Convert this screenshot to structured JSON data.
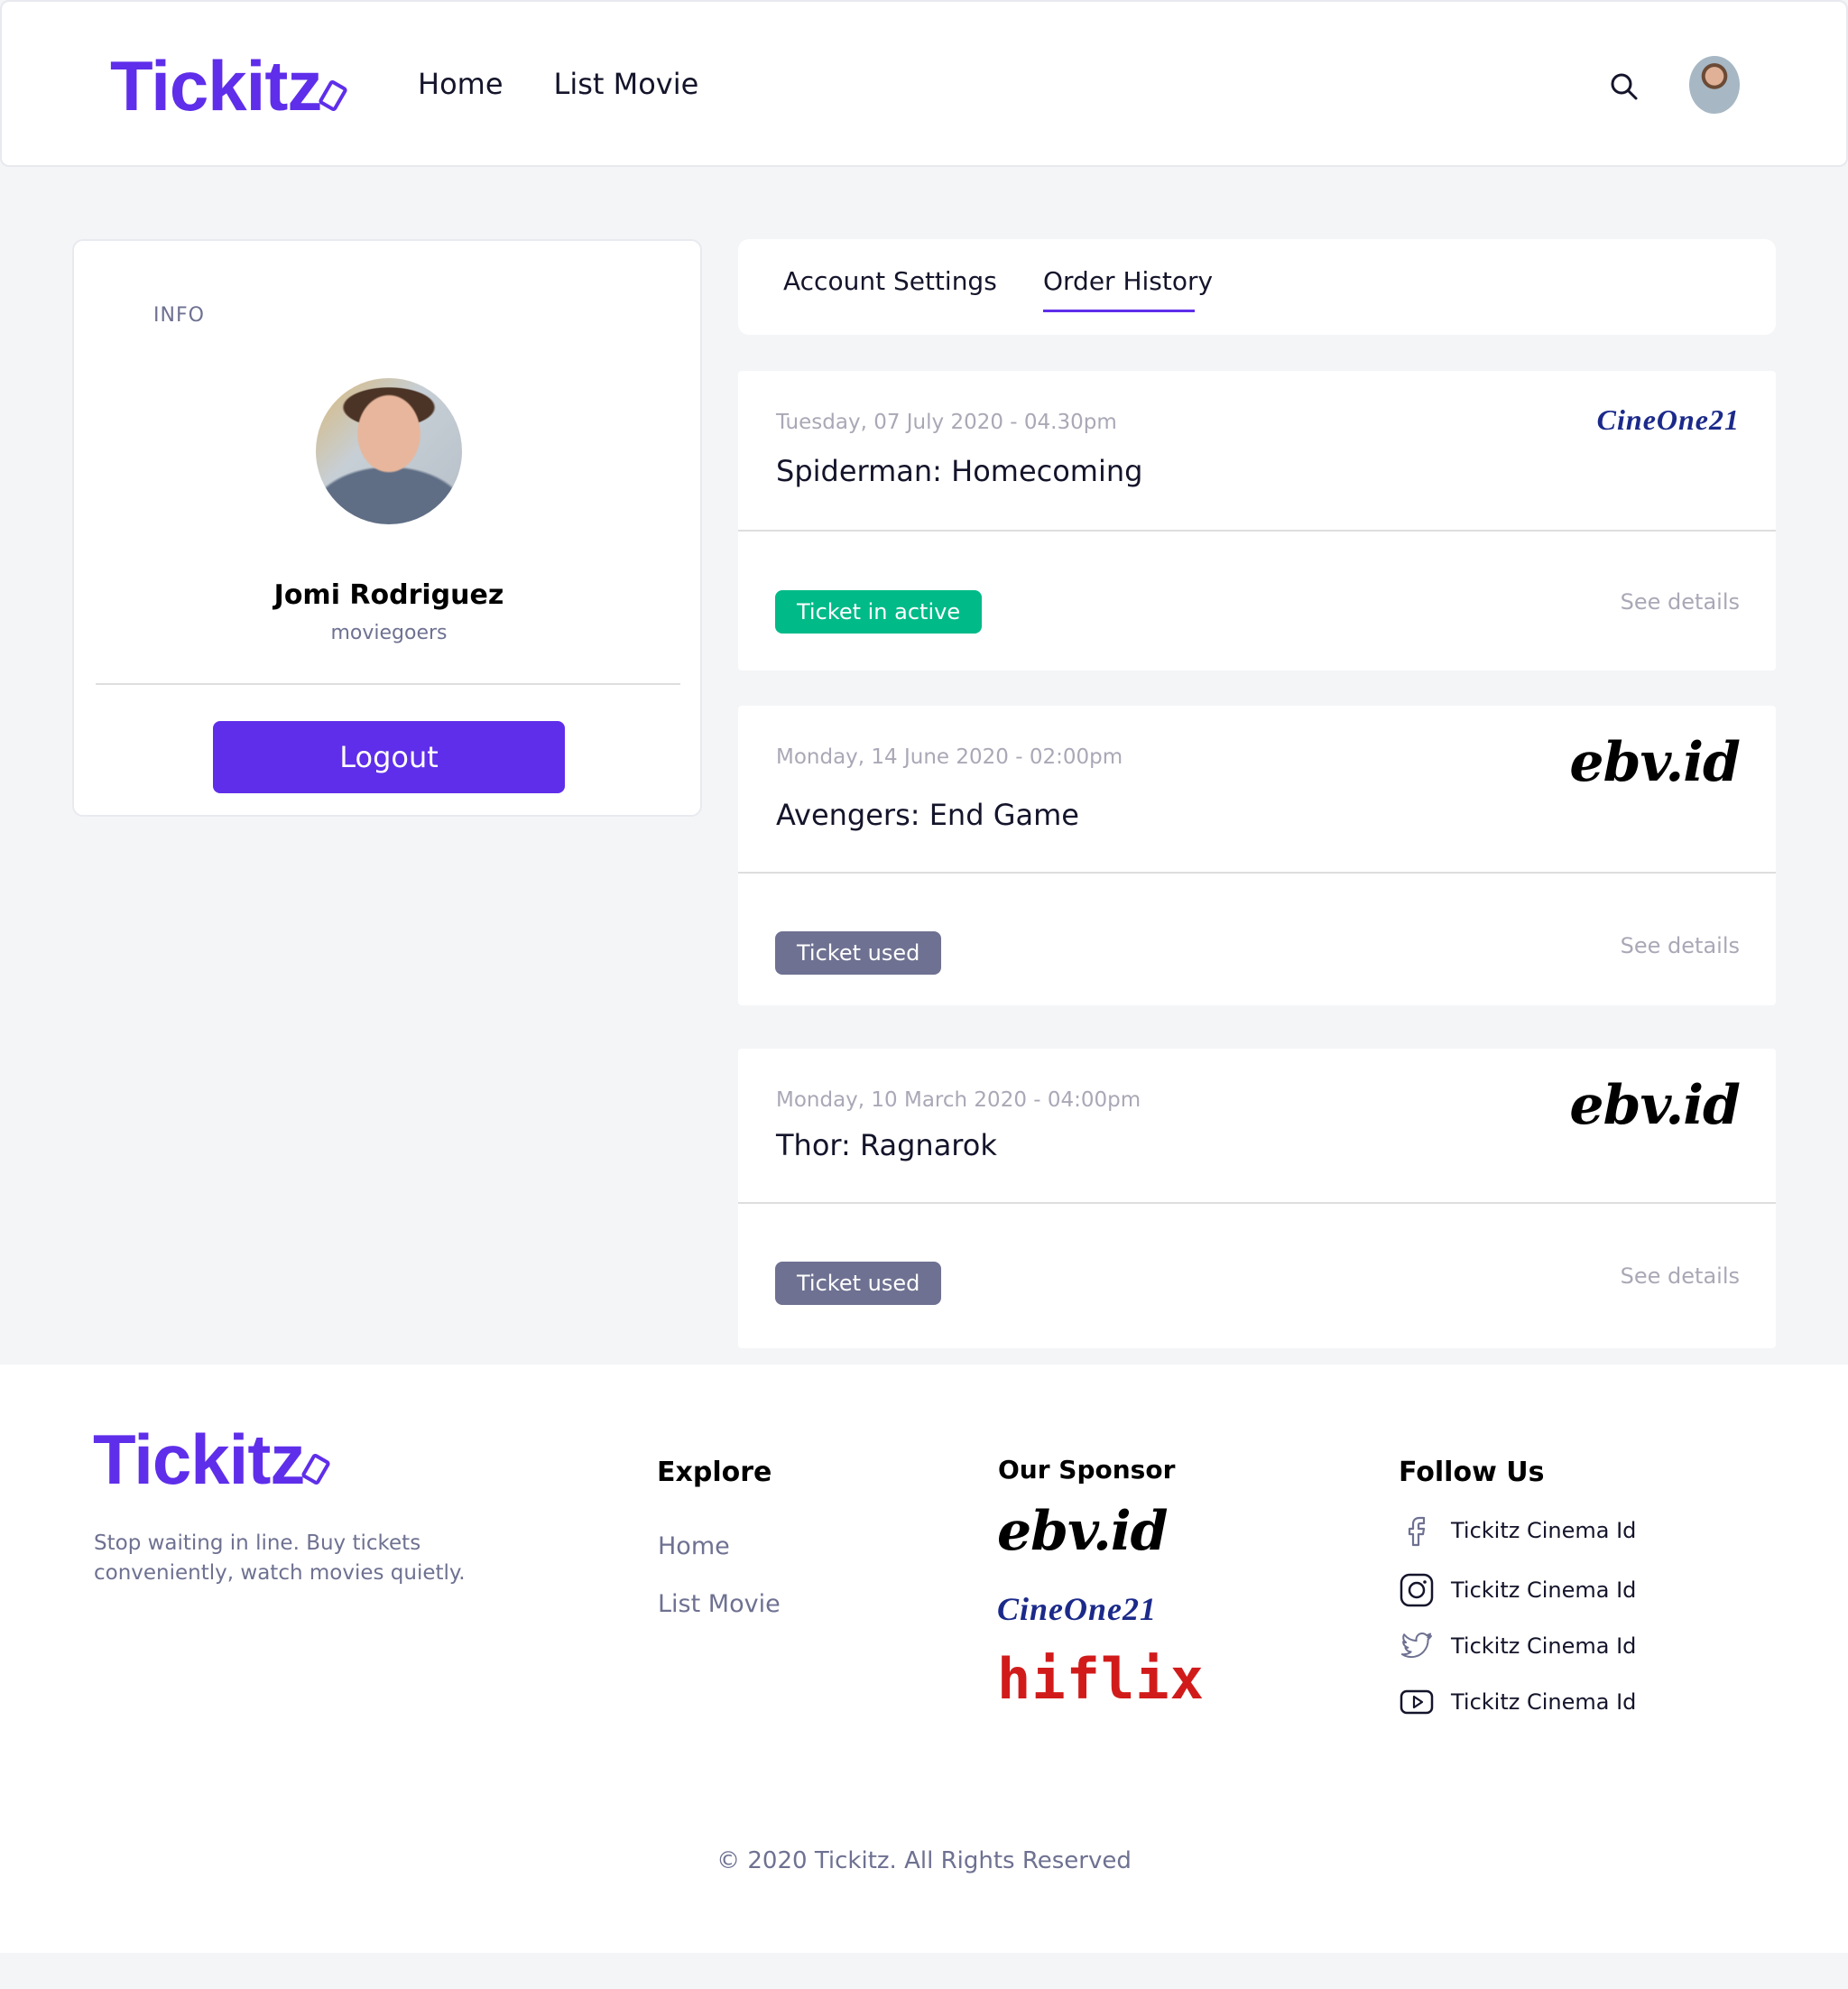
{
  "header": {
    "logo": "Tickitz",
    "nav": [
      "Home",
      "List Movie"
    ]
  },
  "info": {
    "label": "INFO",
    "name": "Jomi Rodriguez",
    "role": "moviegoers",
    "logout_label": "Logout"
  },
  "tabs": [
    "Account Settings",
    "Order History"
  ],
  "active_tab": "Order History",
  "orders": [
    {
      "date": "Tuesday, 07 July 2020 - 04.30pm",
      "title": "Spiderman: Homecoming",
      "cinema": "CineOne21",
      "status": "Ticket in active",
      "status_color": "#00ba88",
      "action": "See details"
    },
    {
      "date": "Monday, 14 June 2020 - 02:00pm",
      "title": "Avengers: End Game",
      "cinema": "ebv.id",
      "status": "Ticket used",
      "status_color": "#6e7191",
      "action": "See details"
    },
    {
      "date": "Monday, 10 March 2020 - 04:00pm",
      "title": "Thor: Ragnarok",
      "cinema": "ebv.id",
      "status": "Ticket used",
      "status_color": "#6e7191",
      "action": "See details"
    }
  ],
  "footer": {
    "logo": "Tickitz",
    "tagline": "Stop waiting in line. Buy tickets conveniently, watch movies quietly.",
    "explore_heading": "Explore",
    "explore_links": [
      "Home",
      "List Movie"
    ],
    "sponsor_heading": "Our Sponsor",
    "sponsors": [
      "ebv.id",
      "CineOne21",
      "hiflix"
    ],
    "follow_heading": "Follow Us",
    "social": [
      {
        "icon": "facebook-icon",
        "label": "Tickitz Cinema Id"
      },
      {
        "icon": "instagram-icon",
        "label": "Tickitz Cinema Id"
      },
      {
        "icon": "twitter-icon",
        "label": "Tickitz Cinema Id"
      },
      {
        "icon": "youtube-icon",
        "label": "Tickitz Cinema Id"
      }
    ],
    "copyright": "© 2020 Tickitz. All Rights Reserved"
  },
  "colors": {
    "primary": "#5f2eea",
    "active_status": "#00ba88",
    "used_status": "#6e7191",
    "hiflix": "#d11b1b",
    "cineone": "#1b2a8a"
  }
}
